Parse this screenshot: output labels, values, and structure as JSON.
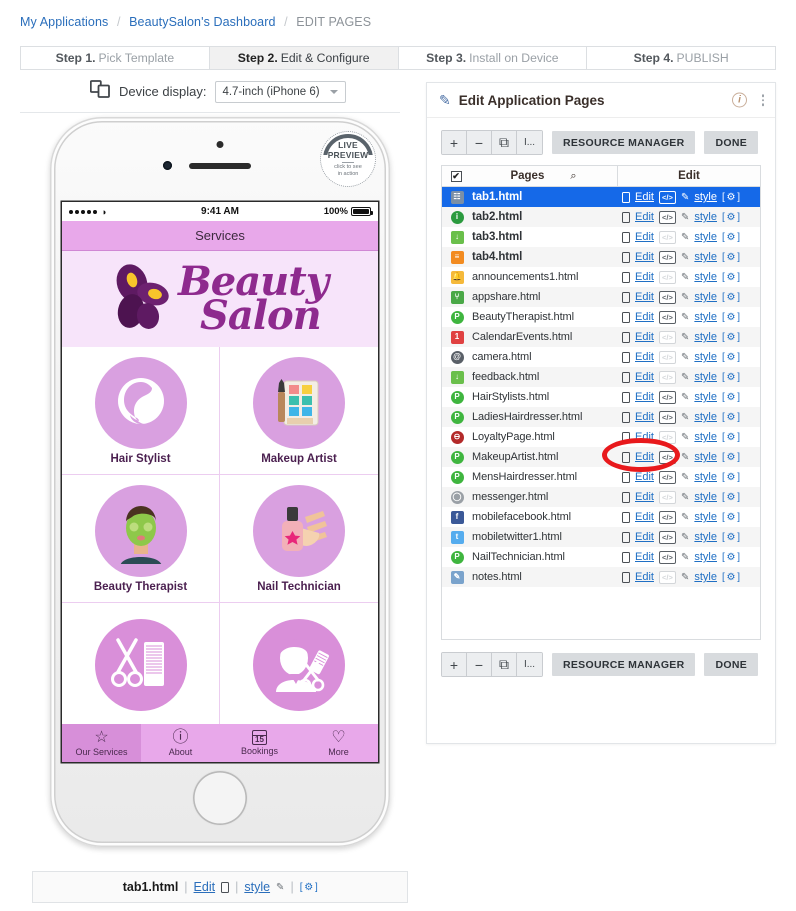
{
  "breadcrumb": {
    "items": [
      {
        "label": "My Applications",
        "link": true
      },
      {
        "label": "BeautySalon's Dashboard",
        "link": true
      },
      {
        "label": "EDIT PAGES",
        "link": false
      }
    ],
    "separator": "/"
  },
  "steps": [
    {
      "num": "Step 1.",
      "label": "Pick Template",
      "active": false
    },
    {
      "num": "Step 2.",
      "label": "Edit & Configure",
      "active": true
    },
    {
      "num": "Step 3.",
      "label": "Install on Device",
      "active": false
    },
    {
      "num": "Step 4.",
      "label": "PUBLISH",
      "active": false
    }
  ],
  "device": {
    "label": "Device display:",
    "selected": "4.7-inch (iPhone 6)",
    "icon": "devices-icon"
  },
  "preview": {
    "live_badge": {
      "line1": "LIVE",
      "line2": "PREVIEW",
      "line3": "click to see",
      "line4": "in action"
    },
    "status_bar": {
      "carrier_dots": 5,
      "wifi": "wifi-icon",
      "time": "9:41 AM",
      "battery_pct": "100%"
    },
    "nav_title": "Services",
    "logo": {
      "line1": "Beauty",
      "line2": "Salon",
      "mark": "butterfly-icon"
    },
    "tiles": [
      {
        "caption": "Hair Stylist",
        "icon": "hair-stylist-icon",
        "glyph": "👩",
        "bg": "#d9a0e0"
      },
      {
        "caption": "Makeup Artist",
        "icon": "makeup-palette-icon",
        "glyph": "🎨",
        "bg": "#d9a0e0"
      },
      {
        "caption": "Beauty Therapist",
        "icon": "facial-mask-icon",
        "glyph": "💆",
        "bg": "#d9a0e0"
      },
      {
        "caption": "Nail Technician",
        "icon": "nail-polish-icon",
        "glyph": "💅",
        "bg": "#d9a0e0"
      },
      {
        "caption": "",
        "icon": "scissors-comb-icon",
        "glyph": "✂",
        "bg": "#d98fd9"
      },
      {
        "caption": "",
        "icon": "barber-icon",
        "glyph": "💈",
        "bg": "#d98fd9"
      }
    ],
    "tabbar": [
      {
        "label": "Our Services",
        "icon": "star-icon",
        "glyph": "☆",
        "selected": true
      },
      {
        "label": "About",
        "icon": "info-bubble-icon",
        "glyph": "ⓘ",
        "selected": false
      },
      {
        "label": "Bookings",
        "icon": "calendar-icon",
        "glyph": "15",
        "selected": false
      },
      {
        "label": "More",
        "icon": "heart-icon",
        "glyph": "♡",
        "selected": false
      }
    ]
  },
  "file_strip": {
    "filename": "tab1.html",
    "edit_label": "Edit",
    "style_label": "style",
    "gear_label": "[ ⚙ ]",
    "divider": "|"
  },
  "panel": {
    "title": "Edit Application Pages",
    "pencil_icon": "pencil-icon",
    "info_icon": "info-icon",
    "kebab_icon": "more-vertical-icon",
    "toolbar": {
      "add": "+",
      "remove": "−",
      "duplicate": "⧉",
      "rename": "I...",
      "resource_manager": "RESOURCE MANAGER",
      "done": "DONE"
    },
    "table": {
      "headers": {
        "check": "✔",
        "pages": "Pages",
        "search": "⌕",
        "edit": "Edit"
      },
      "action_labels": {
        "edit": "Edit",
        "style": "style",
        "gear": "[ ⚙ ]"
      },
      "rows": [
        {
          "name": "tab1.html",
          "icon": "page-doc-icon",
          "badge": "☷",
          "color": "#7b8fa6",
          "bold": true,
          "selected": true,
          "code_enabled": true
        },
        {
          "name": "tab2.html",
          "icon": "info-green-icon",
          "badge": "i",
          "color": "#2b9a3e",
          "bold": true,
          "selected": false,
          "code_enabled": true
        },
        {
          "name": "tab3.html",
          "icon": "download-green-icon",
          "badge": "↓",
          "color": "#6abf4b",
          "bold": true,
          "selected": false,
          "code_enabled": false
        },
        {
          "name": "tab4.html",
          "icon": "orange-stack-icon",
          "badge": "≡",
          "color": "#f28b20",
          "bold": true,
          "selected": false,
          "code_enabled": true
        },
        {
          "name": "announcements1.html",
          "icon": "bell-icon",
          "badge": "🔔",
          "color": "#f5b93b",
          "bold": false,
          "selected": false,
          "code_enabled": false
        },
        {
          "name": "appshare.html",
          "icon": "share-green-icon",
          "badge": "⑂",
          "color": "#4aa847",
          "bold": false,
          "selected": false,
          "code_enabled": true
        },
        {
          "name": "BeautyTherapist.html",
          "icon": "page-green-p-icon",
          "badge": "P",
          "color": "#3fb53f",
          "bold": false,
          "selected": false,
          "code_enabled": true
        },
        {
          "name": "CalendarEvents.html",
          "icon": "calendar-red-icon",
          "badge": "1",
          "color": "#e04141",
          "bold": false,
          "selected": false,
          "code_enabled": false
        },
        {
          "name": "camera.html",
          "icon": "camera-icon",
          "badge": "@",
          "color": "#5a6068",
          "bold": false,
          "selected": false,
          "code_enabled": false
        },
        {
          "name": "feedback.html",
          "icon": "download-green-icon",
          "badge": "↓",
          "color": "#6abf4b",
          "bold": false,
          "selected": false,
          "code_enabled": false
        },
        {
          "name": "HairStylists.html",
          "icon": "page-green-p-icon",
          "badge": "P",
          "color": "#3fb53f",
          "bold": false,
          "selected": false,
          "code_enabled": true
        },
        {
          "name": "LadiesHairdresser.html",
          "icon": "page-green-p-icon",
          "badge": "P",
          "color": "#3fb53f",
          "bold": false,
          "selected": false,
          "code_enabled": true
        },
        {
          "name": "LoyaltyPage.html",
          "icon": "minus-red-circle-icon",
          "badge": "⊖",
          "color": "#b32a2a",
          "bold": false,
          "selected": false,
          "code_enabled": false
        },
        {
          "name": "MakeupArtist.html",
          "icon": "page-green-p-icon",
          "badge": "P",
          "color": "#3fb53f",
          "bold": false,
          "selected": false,
          "code_enabled": true
        },
        {
          "name": "MensHairdresser.html",
          "icon": "page-green-p-icon",
          "badge": "P",
          "color": "#3fb53f",
          "bold": false,
          "selected": false,
          "code_enabled": true
        },
        {
          "name": "messenger.html",
          "icon": "chat-bubble-icon",
          "badge": "◯",
          "color": "#9aa0a6",
          "bold": false,
          "selected": false,
          "code_enabled": false
        },
        {
          "name": "mobilefacebook.html",
          "icon": "facebook-icon",
          "badge": "f",
          "color": "#3b5998",
          "bold": false,
          "selected": false,
          "code_enabled": true
        },
        {
          "name": "mobiletwitter1.html",
          "icon": "twitter-icon",
          "badge": "t",
          "color": "#55acee",
          "bold": false,
          "selected": false,
          "code_enabled": true
        },
        {
          "name": "NailTechnician.html",
          "icon": "page-green-p-icon",
          "badge": "P",
          "color": "#3fb53f",
          "bold": false,
          "selected": false,
          "code_enabled": true
        },
        {
          "name": "notes.html",
          "icon": "notes-pencil-icon",
          "badge": "✎",
          "color": "#7aa3cc",
          "bold": false,
          "selected": false,
          "code_enabled": false
        }
      ]
    }
  },
  "annotation": {
    "shape": "red-ellipse",
    "target": "LoyaltyPage.html Edit link",
    "color": "#e8191c"
  }
}
